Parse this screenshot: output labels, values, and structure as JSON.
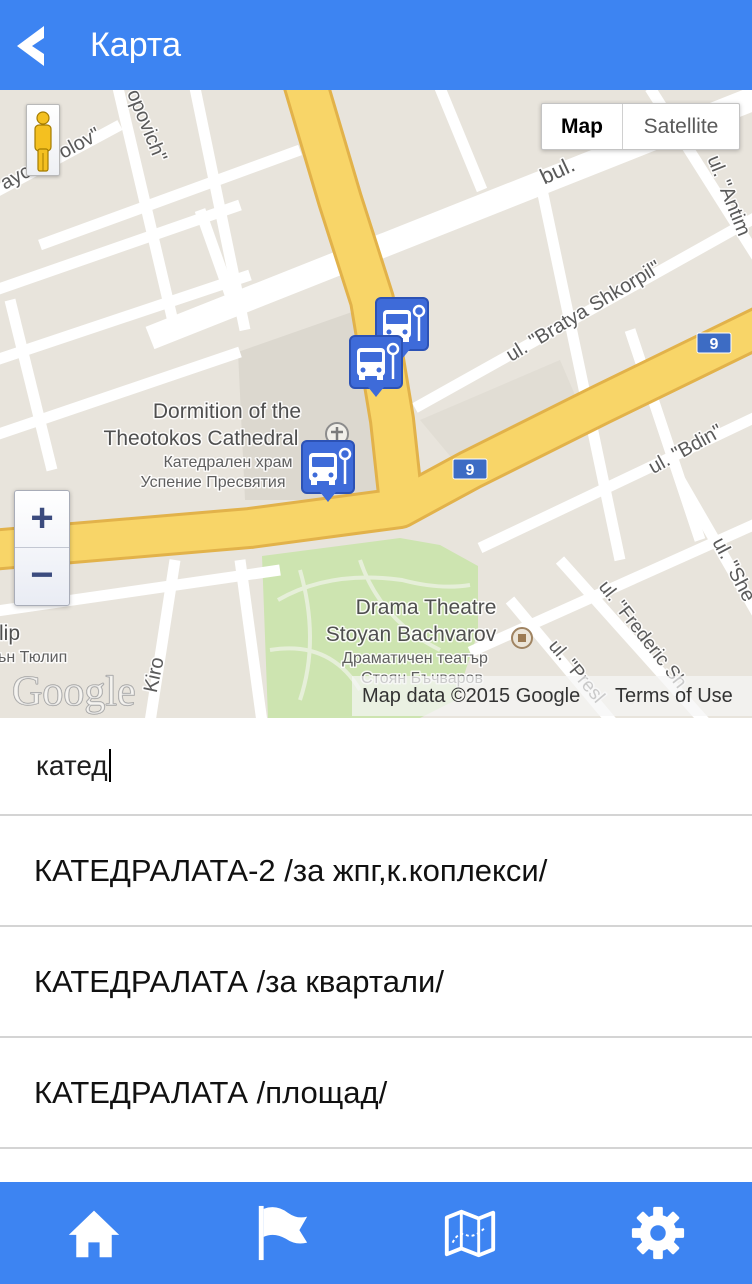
{
  "header": {
    "title": "Карта",
    "back_icon": "back-arrow-icon"
  },
  "colors": {
    "primary": "#3d84f2",
    "marker": "#3e6bd9",
    "major_road": "#f8d568",
    "park": "#cde4b0",
    "land": "#e8e4dc"
  },
  "map": {
    "type_toggle": {
      "map_label": "Map",
      "satellite_label": "Satellite",
      "selected": "Map"
    },
    "zoom": {
      "in_label": "+",
      "out_label": "−"
    },
    "pegman_icon": "pegman-icon",
    "labels": {
      "cathedral_en_1": "Dormition of the",
      "cathedral_en_2": "Theotokos Cathedral",
      "cathedral_bg_1": "Катедрален храм",
      "cathedral_bg_2": "Успение Пресвятия",
      "theatre_en_1": "Drama Theatre",
      "theatre_en_2": "Stoyan Bachvarov",
      "theatre_bg_1": "Драматичен театър",
      "theatre_bg_2": "Стоян Бъчваров",
      "street_bratya_shkorpil": "ul. \"Bratya Shkorpil\"",
      "street_bdin": "ul. \"Bdin\"",
      "street_bul": "bul.",
      "street_antim": "ul. \"Antim",
      "street_frederic": "ul. \"Frederic Sh",
      "street_presl": "ul. \"Presl",
      "street_she": "ul. \"She",
      "street_kiro": "Kiro",
      "street_popovich": "opovich\"",
      "street_ayc": "ayc",
      "street_olov": "olov\"",
      "place_lip": "lip",
      "place_tyulip": "ьн Тюлип"
    },
    "route_shields": [
      "9",
      "9"
    ],
    "markers": [
      {
        "icon": "bus-stop-icon"
      },
      {
        "icon": "bus-stop-icon"
      },
      {
        "icon": "bus-stop-icon"
      }
    ],
    "logo": "Google",
    "attribution": {
      "data": "Map data ©2015 Google",
      "terms": "Terms of Use"
    }
  },
  "search": {
    "value": "катед"
  },
  "results": [
    {
      "label": "КАТЕДРАЛАТА-2 /за жпг,к.коплекси/"
    },
    {
      "label": "КАТЕДРАЛАТА /за квартали/"
    },
    {
      "label": "КАТЕДРАЛАТА /площад/"
    }
  ],
  "bottom_nav": [
    {
      "icon": "home-icon"
    },
    {
      "icon": "flag-icon"
    },
    {
      "icon": "map-icon"
    },
    {
      "icon": "gear-icon"
    }
  ]
}
